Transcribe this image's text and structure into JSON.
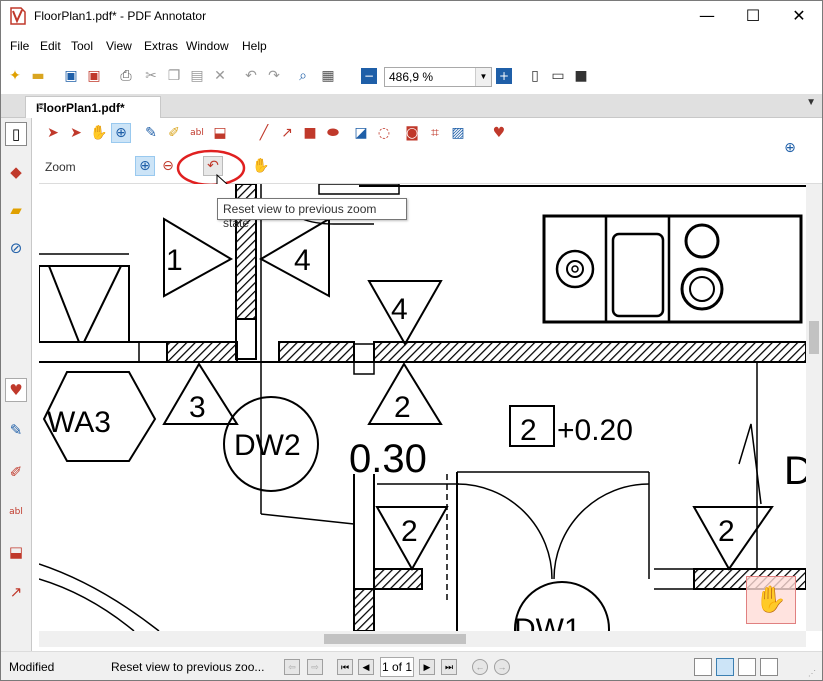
{
  "window": {
    "title": "FloorPlan1.pdf* - PDF Annotator",
    "minimize": "—",
    "maximize": "☐",
    "close": "✕"
  },
  "menu": [
    "File",
    "Edit",
    "Tool",
    "View",
    "Extras",
    "Window",
    "Help"
  ],
  "toolbar": {
    "zoom_value": "486,9 %"
  },
  "tabs": {
    "document": "FloorPlan1.pdf*"
  },
  "tool_panel": {
    "zoom_label": "Zoom",
    "tooltip": "Reset view to previous zoom state"
  },
  "drawing": {
    "labels": {
      "t1": "1",
      "t4a": "4",
      "t4b": "4",
      "wa3": "WA3",
      "t3": "3",
      "dw2": "DW2",
      "t2a": "2",
      "box2": "2",
      "plus": "+0.20",
      "dim": "0.30",
      "t2b": "2",
      "t2c": "2",
      "dw1": "DW1",
      "d": "D"
    }
  },
  "status": {
    "state": "Modified",
    "hint": "Reset view to previous zoo...",
    "page": "1 of 1"
  },
  "colors": {
    "accent": "#c0392b",
    "selected": "#cce4f7",
    "tool_blue": "#1f5fa8"
  }
}
